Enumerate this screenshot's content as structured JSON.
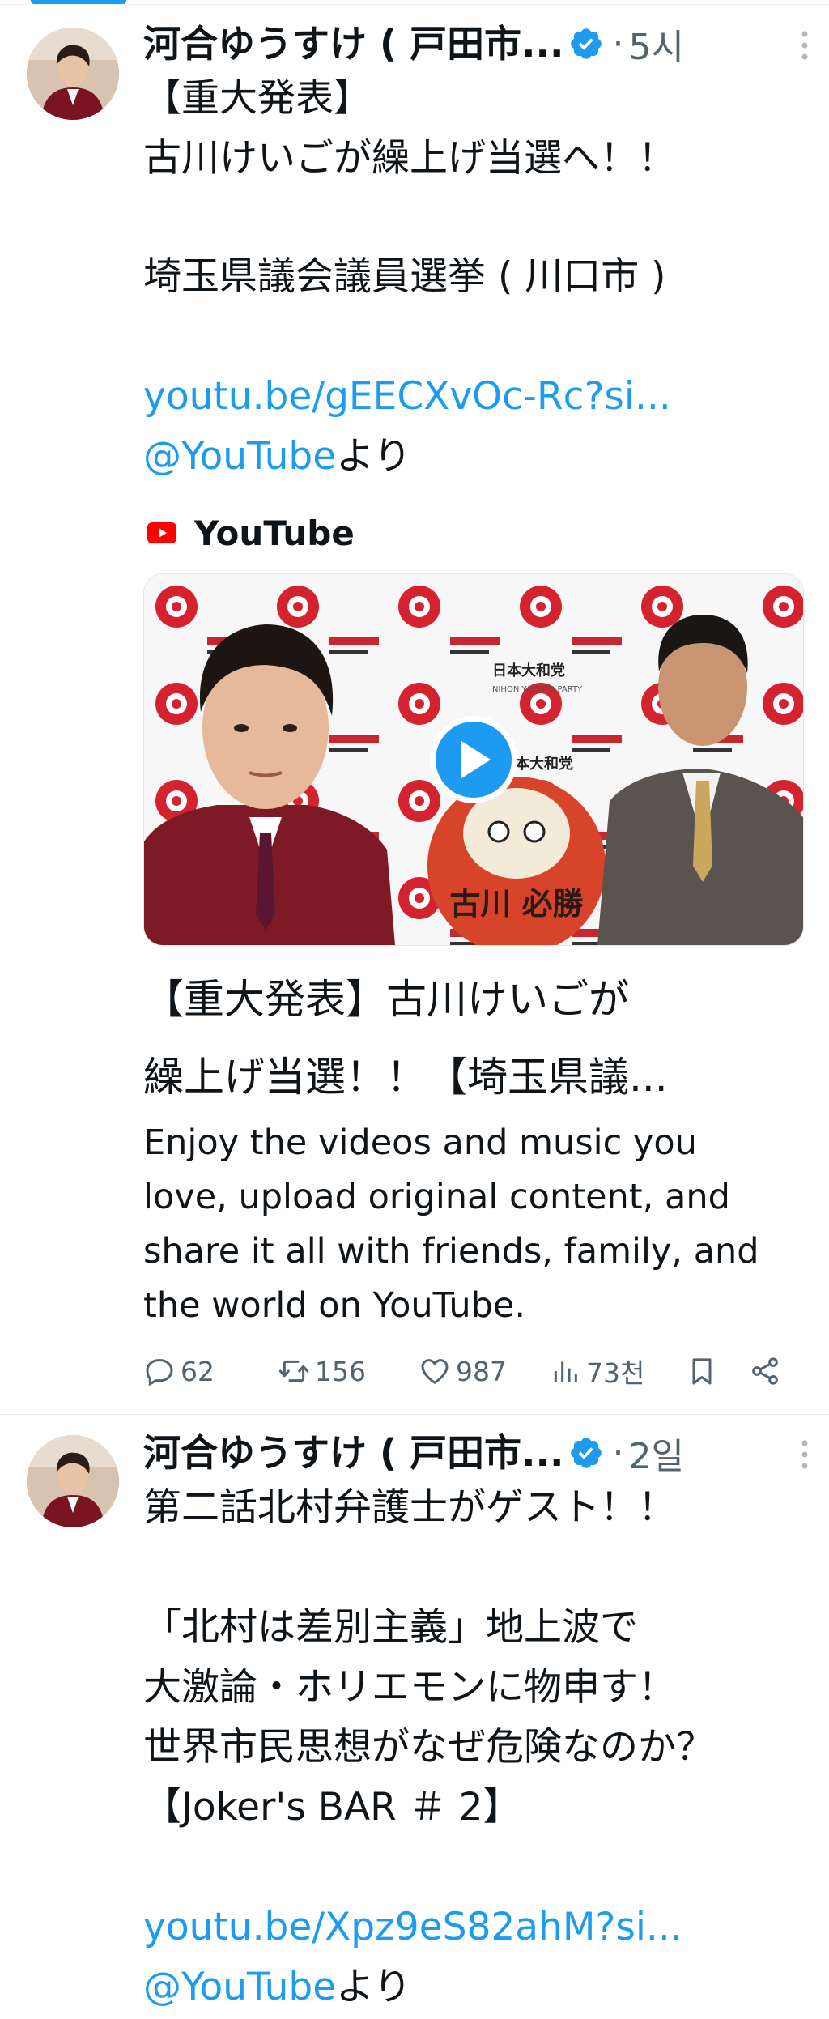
{
  "tweets": [
    {
      "author": {
        "display_name": "河合ゆうすけ ( 戸田市...",
        "verified": true
      },
      "time": "5시",
      "text_lines": [
        "【重大発表】",
        "古川けいごが繰上げ当選へ！！",
        "",
        "埼玉県議会議員選挙 ( 川口市 )",
        ""
      ],
      "link_url": "youtu.be/gEECXvOc-Rc?si...",
      "link_mention": "@YouTube",
      "link_suffix": "より",
      "card": {
        "source": "YouTube",
        "title_lines": [
          "【重大発表】古川けいごが",
          "繰上げ当選！！【埼玉県議..."
        ],
        "description_lines": [
          "Enjoy the videos and music you",
          "love, upload original content, and",
          "share it all with friends, family, and",
          "the world on YouTube."
        ],
        "thumbnail_backdrop_text": [
          "日本大和党",
          "NIHON YAMATO PARTY"
        ],
        "daruma_text": "古川 必勝"
      },
      "actions": {
        "replies": "62",
        "reposts": "156",
        "likes": "987",
        "views": "73천"
      }
    },
    {
      "author": {
        "display_name": "河合ゆうすけ ( 戸田市...",
        "verified": true
      },
      "time": "2일",
      "text_lines": [
        "第二話北村弁護士がゲスト！！",
        "",
        "「北村は差別主義」地上波で",
        "大激論・ホリエモンに物申す！",
        "世界市民思想がなぜ危険なのか？",
        "【Joker's BAR ＃ 2】",
        ""
      ],
      "link_url": "youtu.be/Xpz9eS82ahM?si...",
      "link_mention": "@YouTube",
      "link_suffix": "より"
    }
  ],
  "colors": {
    "accent": "#1d9bf0",
    "text": "#0f1419",
    "muted": "#536471",
    "youtube_red": "#ff0000"
  },
  "icons": {
    "verified": "verified-badge-icon",
    "more": "more-vertical-icon",
    "reply": "reply-icon",
    "repost": "repost-icon",
    "like": "heart-icon",
    "views": "views-chart-icon",
    "bookmark": "bookmark-icon",
    "share": "share-icon",
    "play": "play-icon"
  }
}
